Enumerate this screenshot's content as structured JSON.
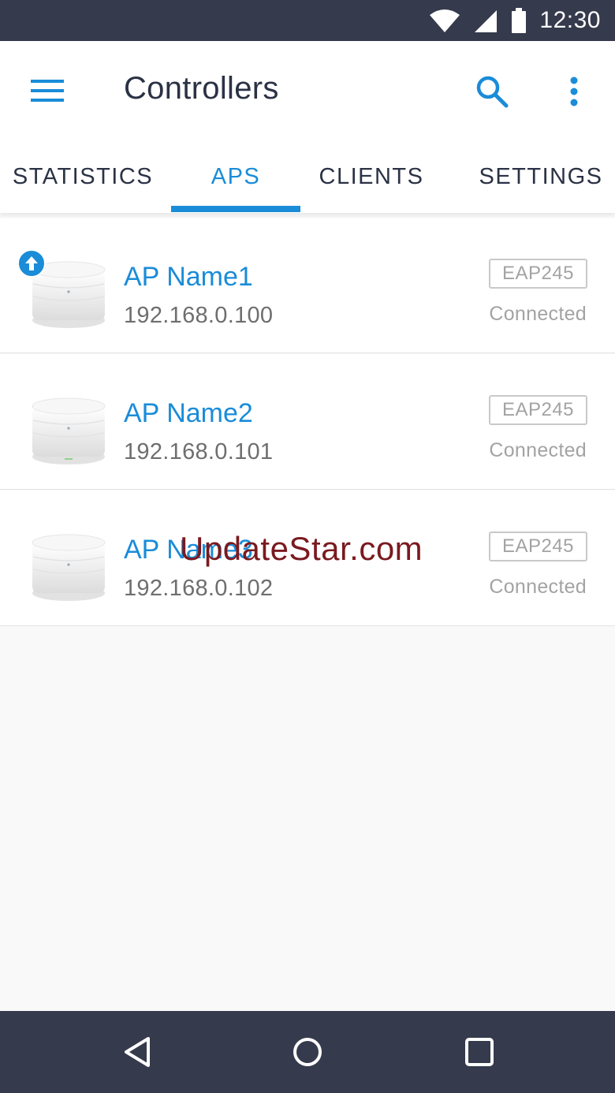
{
  "status_bar": {
    "time": "12:30",
    "icons": [
      "wifi-icon",
      "cellular-signal-icon",
      "battery-icon"
    ]
  },
  "app_bar": {
    "title": "Controllers",
    "menu_icon": "hamburger-menu-icon",
    "search_icon": "search-icon",
    "more_icon": "more-vertical-icon"
  },
  "tabs": [
    {
      "label": "STATISTICS",
      "active": false
    },
    {
      "label": "APS",
      "active": true
    },
    {
      "label": "CLIENTS",
      "active": false
    },
    {
      "label": "SETTINGS",
      "active": false
    }
  ],
  "aps": [
    {
      "name": "AP Name1",
      "ip": "192.168.0.100",
      "model": "EAP245",
      "status": "Connected",
      "upgrade_available": true
    },
    {
      "name": "AP Name2",
      "ip": "192.168.0.101",
      "model": "EAP245",
      "status": "Connected",
      "upgrade_available": false
    },
    {
      "name": "AP Name3",
      "ip": "192.168.0.102",
      "model": "EAP245",
      "status": "Connected",
      "upgrade_available": false
    }
  ],
  "watermark": "UpdateStar.com",
  "nav_bar": {
    "icons": [
      "back-icon",
      "home-icon",
      "recents-icon"
    ]
  },
  "colors": {
    "accent": "#1a8cd8",
    "system_bar": "#353a4c",
    "title_text": "#2b3245",
    "secondary_text": "#6e6e6e",
    "muted_text": "#a3a3a3",
    "watermark": "#7a1a1f"
  }
}
